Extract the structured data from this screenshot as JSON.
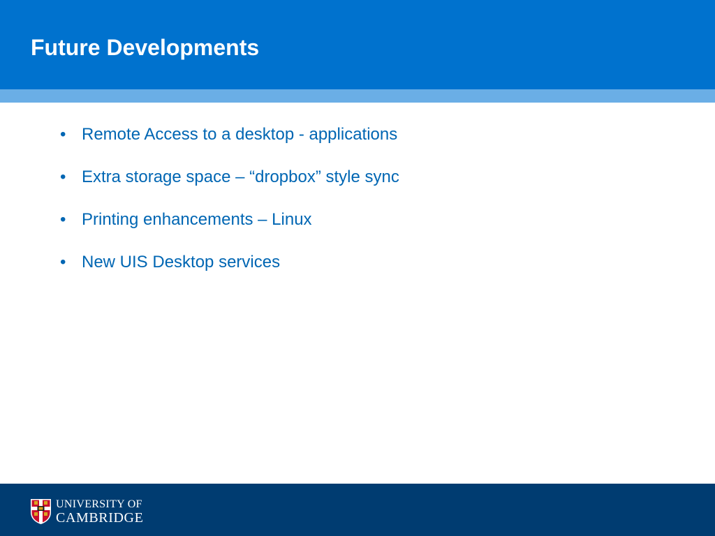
{
  "slide": {
    "title": "Future Developments",
    "bullets": [
      "Remote Access to a desktop - applications",
      "Extra storage space – “dropbox” style sync",
      "Printing enhancements – Linux",
      "New UIS Desktop services"
    ],
    "bullet_symbol": "•"
  },
  "footer": {
    "logo_line1": "UNIVERSITY OF",
    "logo_line2": "CAMBRIDGE",
    "logo_icon": "university-crest-icon"
  },
  "colors": {
    "header": "#0072ce",
    "header_stripe": "#6aaee6",
    "footer": "#003c71",
    "bullet_text": "#0066b3",
    "title_text": "#ffffff"
  }
}
